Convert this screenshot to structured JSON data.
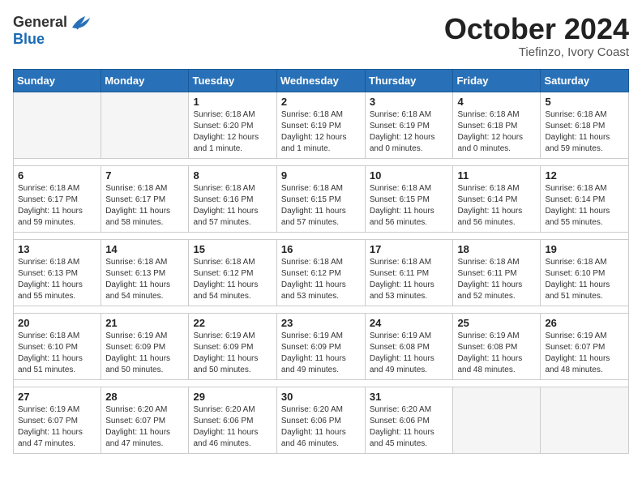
{
  "header": {
    "logo_general": "General",
    "logo_blue": "Blue",
    "month_title": "October 2024",
    "subtitle": "Tiefinzo, Ivory Coast"
  },
  "days_of_week": [
    "Sunday",
    "Monday",
    "Tuesday",
    "Wednesday",
    "Thursday",
    "Friday",
    "Saturday"
  ],
  "weeks": [
    [
      {
        "day": "",
        "info": ""
      },
      {
        "day": "",
        "info": ""
      },
      {
        "day": "1",
        "info": "Sunrise: 6:18 AM\nSunset: 6:20 PM\nDaylight: 12 hours and 1 minute."
      },
      {
        "day": "2",
        "info": "Sunrise: 6:18 AM\nSunset: 6:19 PM\nDaylight: 12 hours and 1 minute."
      },
      {
        "day": "3",
        "info": "Sunrise: 6:18 AM\nSunset: 6:19 PM\nDaylight: 12 hours and 0 minutes."
      },
      {
        "day": "4",
        "info": "Sunrise: 6:18 AM\nSunset: 6:18 PM\nDaylight: 12 hours and 0 minutes."
      },
      {
        "day": "5",
        "info": "Sunrise: 6:18 AM\nSunset: 6:18 PM\nDaylight: 11 hours and 59 minutes."
      }
    ],
    [
      {
        "day": "6",
        "info": "Sunrise: 6:18 AM\nSunset: 6:17 PM\nDaylight: 11 hours and 59 minutes."
      },
      {
        "day": "7",
        "info": "Sunrise: 6:18 AM\nSunset: 6:17 PM\nDaylight: 11 hours and 58 minutes."
      },
      {
        "day": "8",
        "info": "Sunrise: 6:18 AM\nSunset: 6:16 PM\nDaylight: 11 hours and 57 minutes."
      },
      {
        "day": "9",
        "info": "Sunrise: 6:18 AM\nSunset: 6:15 PM\nDaylight: 11 hours and 57 minutes."
      },
      {
        "day": "10",
        "info": "Sunrise: 6:18 AM\nSunset: 6:15 PM\nDaylight: 11 hours and 56 minutes."
      },
      {
        "day": "11",
        "info": "Sunrise: 6:18 AM\nSunset: 6:14 PM\nDaylight: 11 hours and 56 minutes."
      },
      {
        "day": "12",
        "info": "Sunrise: 6:18 AM\nSunset: 6:14 PM\nDaylight: 11 hours and 55 minutes."
      }
    ],
    [
      {
        "day": "13",
        "info": "Sunrise: 6:18 AM\nSunset: 6:13 PM\nDaylight: 11 hours and 55 minutes."
      },
      {
        "day": "14",
        "info": "Sunrise: 6:18 AM\nSunset: 6:13 PM\nDaylight: 11 hours and 54 minutes."
      },
      {
        "day": "15",
        "info": "Sunrise: 6:18 AM\nSunset: 6:12 PM\nDaylight: 11 hours and 54 minutes."
      },
      {
        "day": "16",
        "info": "Sunrise: 6:18 AM\nSunset: 6:12 PM\nDaylight: 11 hours and 53 minutes."
      },
      {
        "day": "17",
        "info": "Sunrise: 6:18 AM\nSunset: 6:11 PM\nDaylight: 11 hours and 53 minutes."
      },
      {
        "day": "18",
        "info": "Sunrise: 6:18 AM\nSunset: 6:11 PM\nDaylight: 11 hours and 52 minutes."
      },
      {
        "day": "19",
        "info": "Sunrise: 6:18 AM\nSunset: 6:10 PM\nDaylight: 11 hours and 51 minutes."
      }
    ],
    [
      {
        "day": "20",
        "info": "Sunrise: 6:18 AM\nSunset: 6:10 PM\nDaylight: 11 hours and 51 minutes."
      },
      {
        "day": "21",
        "info": "Sunrise: 6:19 AM\nSunset: 6:09 PM\nDaylight: 11 hours and 50 minutes."
      },
      {
        "day": "22",
        "info": "Sunrise: 6:19 AM\nSunset: 6:09 PM\nDaylight: 11 hours and 50 minutes."
      },
      {
        "day": "23",
        "info": "Sunrise: 6:19 AM\nSunset: 6:09 PM\nDaylight: 11 hours and 49 minutes."
      },
      {
        "day": "24",
        "info": "Sunrise: 6:19 AM\nSunset: 6:08 PM\nDaylight: 11 hours and 49 minutes."
      },
      {
        "day": "25",
        "info": "Sunrise: 6:19 AM\nSunset: 6:08 PM\nDaylight: 11 hours and 48 minutes."
      },
      {
        "day": "26",
        "info": "Sunrise: 6:19 AM\nSunset: 6:07 PM\nDaylight: 11 hours and 48 minutes."
      }
    ],
    [
      {
        "day": "27",
        "info": "Sunrise: 6:19 AM\nSunset: 6:07 PM\nDaylight: 11 hours and 47 minutes."
      },
      {
        "day": "28",
        "info": "Sunrise: 6:20 AM\nSunset: 6:07 PM\nDaylight: 11 hours and 47 minutes."
      },
      {
        "day": "29",
        "info": "Sunrise: 6:20 AM\nSunset: 6:06 PM\nDaylight: 11 hours and 46 minutes."
      },
      {
        "day": "30",
        "info": "Sunrise: 6:20 AM\nSunset: 6:06 PM\nDaylight: 11 hours and 46 minutes."
      },
      {
        "day": "31",
        "info": "Sunrise: 6:20 AM\nSunset: 6:06 PM\nDaylight: 11 hours and 45 minutes."
      },
      {
        "day": "",
        "info": ""
      },
      {
        "day": "",
        "info": ""
      }
    ]
  ]
}
